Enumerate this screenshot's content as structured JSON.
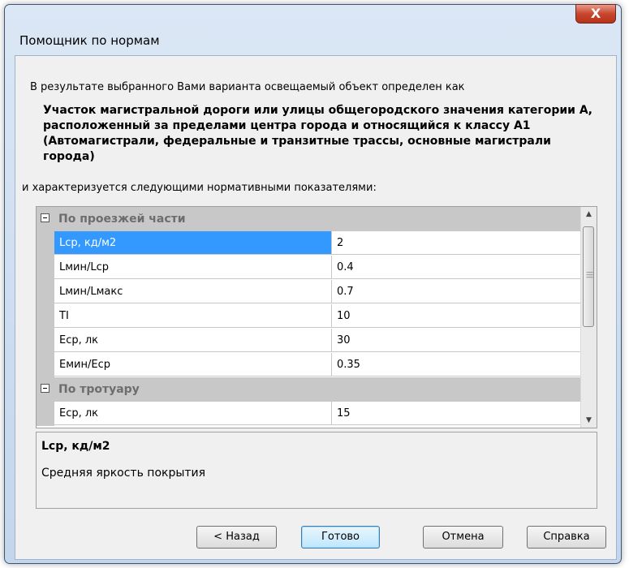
{
  "window": {
    "title": "Помощник по нормам",
    "close_label": "X"
  },
  "intro_text": "В результате выбранного Вами варианта освещаемый объект определен как",
  "object_title": "Участок магистральной дороги или улицы общегородского значения категории А, расположенный за пределами центра города и относящийся к классу А1 (Автомагистрали, федеральные и транзитные трассы, основные магистрали города)",
  "characterized_text": "и характеризуется следующими нормативными показателями:",
  "property_grid": {
    "categories": [
      {
        "label": "По проезжей части",
        "rows": [
          {
            "name": "Lср, кд/м2",
            "value": "2"
          },
          {
            "name": "Lмин/Lср",
            "value": "0.4"
          },
          {
            "name": "Lмин/Lмакс",
            "value": "0.7"
          },
          {
            "name": "TI",
            "value": "10"
          },
          {
            "name": "Eср, лк",
            "value": "30"
          },
          {
            "name": "Eмин/Eср",
            "value": "0.35"
          }
        ]
      },
      {
        "label": "По тротуару",
        "rows": [
          {
            "name": "Eср, лк",
            "value": "15"
          }
        ]
      }
    ],
    "selected": "Lср, кд/м2"
  },
  "description": {
    "title": "Lср, кд/м2",
    "text": "Средняя яркость покрытия"
  },
  "buttons": {
    "back": "< Назад",
    "finish": "Готово",
    "cancel": "Отмена",
    "help": "Справка"
  },
  "colors": {
    "selection": "#3399ff",
    "category_bg": "#c8c8c8",
    "default_button": "#bee6fd"
  }
}
